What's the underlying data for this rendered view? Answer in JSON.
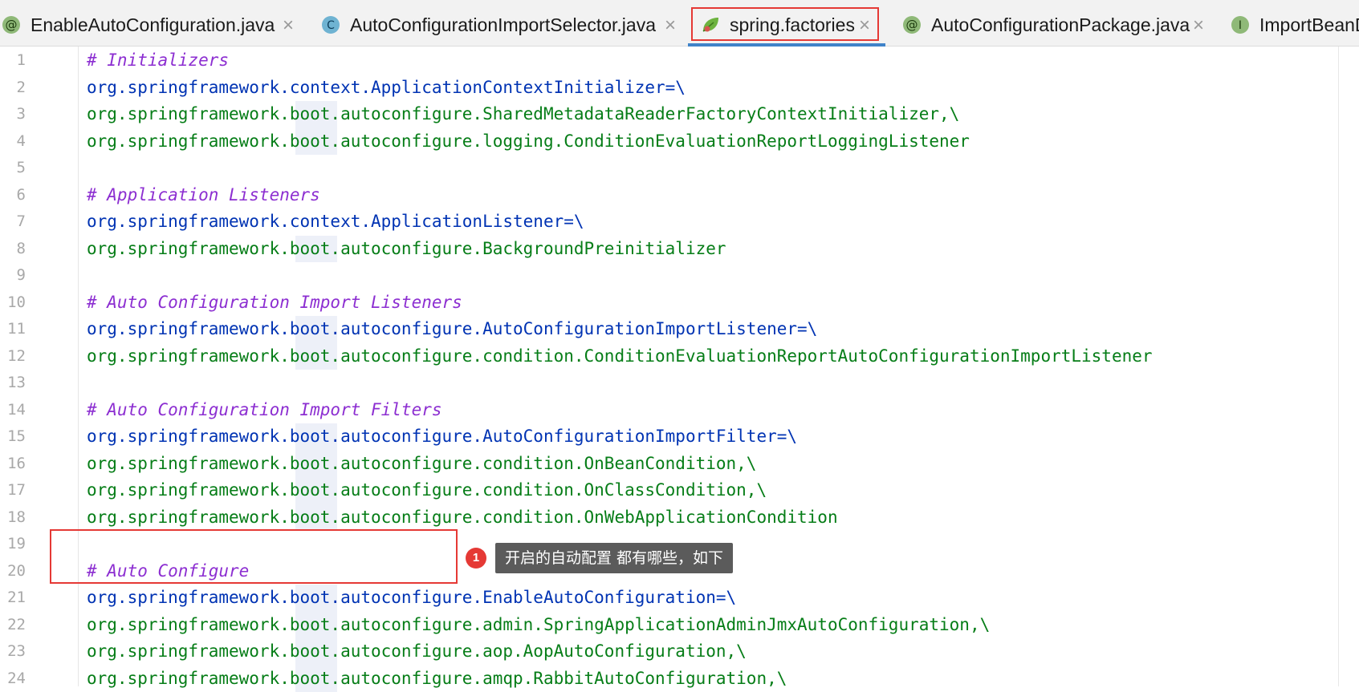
{
  "tabs": [
    {
      "label": "EnableAutoConfiguration.java",
      "icon": "annotation-icon",
      "icon_letter": "@",
      "active": false
    },
    {
      "label": "AutoConfigurationImportSelector.java",
      "icon": "class-icon",
      "icon_letter": "C",
      "active": false
    },
    {
      "label": "spring.factories",
      "icon": "spring-leaf-icon",
      "icon_letter": "",
      "active": true
    },
    {
      "label": "AutoConfigurationPackage.java",
      "icon": "annotation-icon",
      "icon_letter": "@",
      "active": false
    },
    {
      "label": "ImportBeanD",
      "icon": "interface-icon",
      "icon_letter": "I",
      "active": false
    }
  ],
  "close_glyph": "×",
  "lines": [
    {
      "n": "1",
      "kind": "comment",
      "text": "# Initializers"
    },
    {
      "n": "2",
      "kind": "key",
      "text": "org.springframework.context.ApplicationContextInitializer=\\"
    },
    {
      "n": "3",
      "kind": "value",
      "text": "org.springframework.boot.autoconfigure.SharedMetadataReaderFactoryContextInitializer,\\"
    },
    {
      "n": "4",
      "kind": "value",
      "text": "org.springframework.boot.autoconfigure.logging.ConditionEvaluationReportLoggingListener"
    },
    {
      "n": "5",
      "kind": "blank",
      "text": ""
    },
    {
      "n": "6",
      "kind": "comment",
      "text": "# Application Listeners"
    },
    {
      "n": "7",
      "kind": "key",
      "text": "org.springframework.context.ApplicationListener=\\"
    },
    {
      "n": "8",
      "kind": "value",
      "text": "org.springframework.boot.autoconfigure.BackgroundPreinitializer"
    },
    {
      "n": "9",
      "kind": "blank",
      "text": ""
    },
    {
      "n": "10",
      "kind": "comment",
      "text": "# Auto Configuration Import Listeners"
    },
    {
      "n": "11",
      "kind": "key",
      "text": "org.springframework.boot.autoconfigure.AutoConfigurationImportListener=\\"
    },
    {
      "n": "12",
      "kind": "value",
      "text": "org.springframework.boot.autoconfigure.condition.ConditionEvaluationReportAutoConfigurationImportListener"
    },
    {
      "n": "13",
      "kind": "blank",
      "text": ""
    },
    {
      "n": "14",
      "kind": "comment",
      "text": "# Auto Configuration Import Filters"
    },
    {
      "n": "15",
      "kind": "key",
      "text": "org.springframework.boot.autoconfigure.AutoConfigurationImportFilter=\\"
    },
    {
      "n": "16",
      "kind": "value",
      "text": "org.springframework.boot.autoconfigure.condition.OnBeanCondition,\\"
    },
    {
      "n": "17",
      "kind": "value",
      "text": "org.springframework.boot.autoconfigure.condition.OnClassCondition,\\"
    },
    {
      "n": "18",
      "kind": "value",
      "text": "org.springframework.boot.autoconfigure.condition.OnWebApplicationCondition"
    },
    {
      "n": "19",
      "kind": "blank",
      "text": ""
    },
    {
      "n": "20",
      "kind": "comment",
      "text": "# Auto Configure"
    },
    {
      "n": "21",
      "kind": "key",
      "text": "org.springframework.boot.autoconfigure.EnableAutoConfiguration=\\"
    },
    {
      "n": "22",
      "kind": "value",
      "text": "org.springframework.boot.autoconfigure.admin.SpringApplicationAdminJmxAutoConfiguration,\\"
    },
    {
      "n": "23",
      "kind": "value",
      "text": "org.springframework.boot.autoconfigure.aop.AopAutoConfiguration,\\"
    },
    {
      "n": "24",
      "kind": "value",
      "text": "org.springframework.boot.autoconfigure.amqp.RabbitAutoConfiguration,\\"
    }
  ],
  "annotation": {
    "badge": "1",
    "text": "开启的自动配置 都有哪些，如下"
  },
  "colors": {
    "comment": "#8c2ed1",
    "key": "#0033b3",
    "value": "#067d17",
    "highlight": "#e53935",
    "tab_underline": "#4083c9"
  }
}
